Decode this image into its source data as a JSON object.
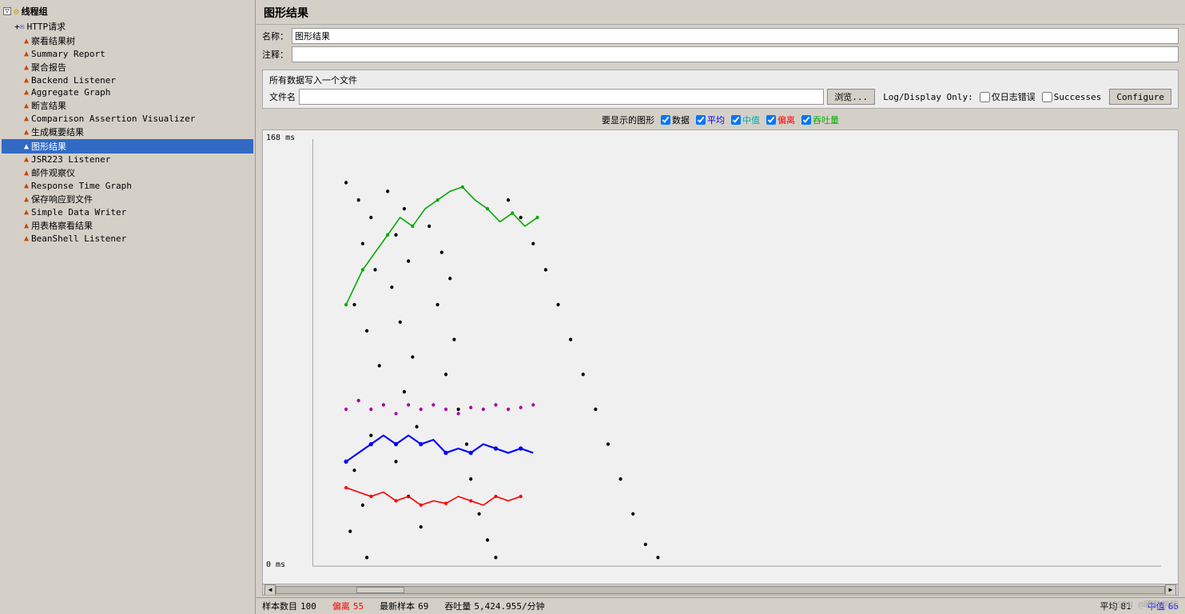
{
  "app": {
    "title": "图形结果"
  },
  "left_panel": {
    "root_label": "线程组",
    "items": [
      {
        "id": "thread-group",
        "label": "线程组",
        "level": 0,
        "type": "root",
        "expanded": true
      },
      {
        "id": "http-request",
        "label": "HTTP请求",
        "level": 1,
        "type": "sampler",
        "expanded": true
      },
      {
        "id": "aggregate-tree",
        "label": "察看结果树",
        "level": 2,
        "type": "listener"
      },
      {
        "id": "summary-report",
        "label": "Summary Report",
        "level": 2,
        "type": "listener"
      },
      {
        "id": "aggregate-report",
        "label": "聚合报告",
        "level": 2,
        "type": "listener"
      },
      {
        "id": "backend-listener",
        "label": "Backend Listener",
        "level": 2,
        "type": "listener"
      },
      {
        "id": "aggregate-graph",
        "label": "Aggregate Graph",
        "level": 2,
        "type": "listener"
      },
      {
        "id": "assertion-result",
        "label": "断言结果",
        "level": 2,
        "type": "listener"
      },
      {
        "id": "comparison-assertion",
        "label": "Comparison Assertion Visualizer",
        "level": 2,
        "type": "listener"
      },
      {
        "id": "generate-summary",
        "label": "生成概要结果",
        "level": 2,
        "type": "listener"
      },
      {
        "id": "graph-result",
        "label": "图形结果",
        "level": 2,
        "type": "listener",
        "selected": true
      },
      {
        "id": "jsr223-listener",
        "label": "JSR223 Listener",
        "level": 2,
        "type": "listener"
      },
      {
        "id": "mail-observer",
        "label": "邮件观察仪",
        "level": 2,
        "type": "listener"
      },
      {
        "id": "response-time-graph",
        "label": "Response Time Graph",
        "level": 2,
        "type": "listener"
      },
      {
        "id": "save-response",
        "label": "保存响应到文件",
        "level": 2,
        "type": "listener"
      },
      {
        "id": "simple-data-writer",
        "label": "Simple Data Writer",
        "level": 2,
        "type": "listener"
      },
      {
        "id": "table-view",
        "label": "用表格察看结果",
        "level": 2,
        "type": "listener"
      },
      {
        "id": "beanshell-listener",
        "label": "BeanShell Listener",
        "level": 2,
        "type": "listener"
      }
    ]
  },
  "right_panel": {
    "title": "图形结果",
    "form": {
      "name_label": "名称：",
      "name_value": "图形结果",
      "comment_label": "注释：",
      "comment_value": ""
    },
    "file_section": {
      "title": "所有数据写入一个文件",
      "file_label": "文件名",
      "file_value": "",
      "browse_btn": "浏览...",
      "log_display_label": "Log/Display Only:",
      "error_only_label": "仅日志错误",
      "success_label": "Successes",
      "configure_btn": "Configure"
    },
    "graph_controls": {
      "label": "要显示的图形",
      "data_label": "数据",
      "avg_label": "平均",
      "median_label": "中值",
      "deviation_label": "偏离",
      "throughput_label": "吞吐量",
      "data_checked": true,
      "avg_checked": true,
      "median_checked": true,
      "deviation_checked": true,
      "throughput_checked": true
    },
    "y_axis_max": "168 ms",
    "y_axis_min": "0 ms",
    "status_bar": {
      "sample_count_label": "样本数目",
      "sample_count_value": "100",
      "deviation_label": "偏离",
      "deviation_value": "55",
      "latest_sample_label": "最新样本",
      "latest_sample_value": "69",
      "throughput_label": "吞吐量",
      "throughput_value": "5,424.955/分钟",
      "avg_label": "平均",
      "avg_value": "81",
      "median_label": "中值",
      "median_value": "66"
    }
  },
  "watermark": "CSDN @晒酷学院"
}
